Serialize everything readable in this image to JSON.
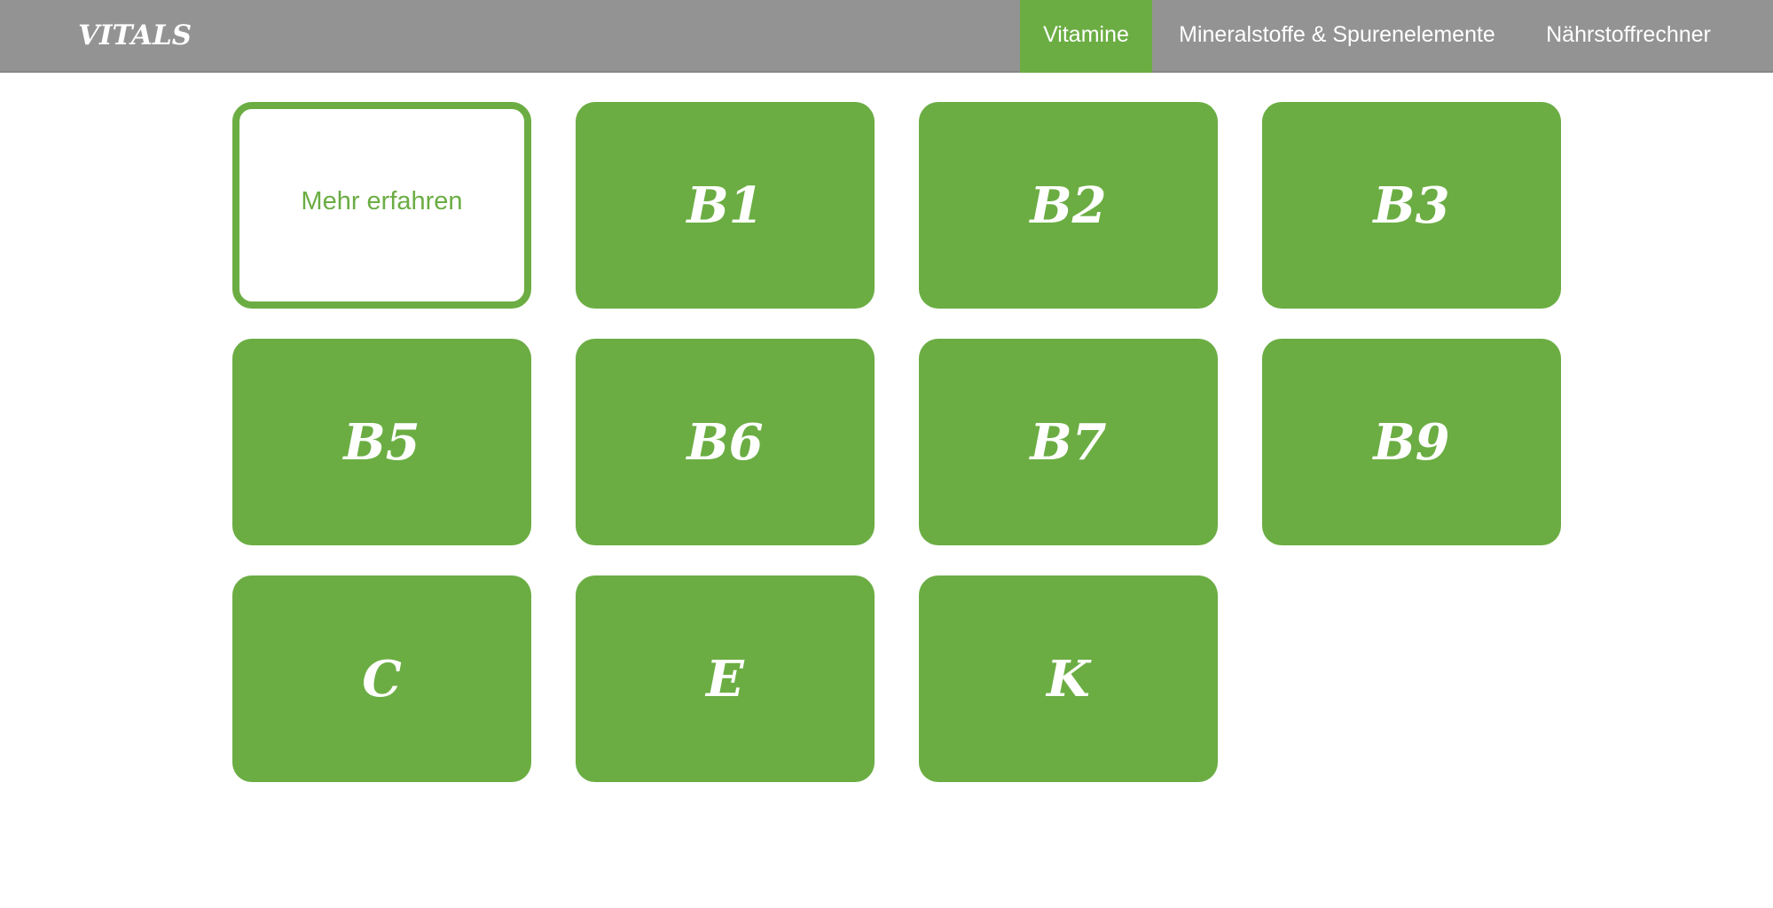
{
  "brand": {
    "logo_text": "VITALS"
  },
  "nav": {
    "tabs": [
      {
        "label": "Vitamine",
        "active": true
      },
      {
        "label": "Mineralstoffe & Spurenelemente",
        "active": false
      },
      {
        "label": "Nährstoffrechner",
        "active": false
      }
    ]
  },
  "colors": {
    "accent": "#6bad43",
    "navbar": "#939393",
    "text_on_accent": "#ffffff"
  },
  "tiles": [
    {
      "label": "Mehr erfahren",
      "style": "outline"
    },
    {
      "label": "B1"
    },
    {
      "label": "B2"
    },
    {
      "label": "B3"
    },
    {
      "label": "B5"
    },
    {
      "label": "B6"
    },
    {
      "label": "B7"
    },
    {
      "label": "B9"
    },
    {
      "label": "C"
    },
    {
      "label": "E"
    },
    {
      "label": "K"
    }
  ]
}
